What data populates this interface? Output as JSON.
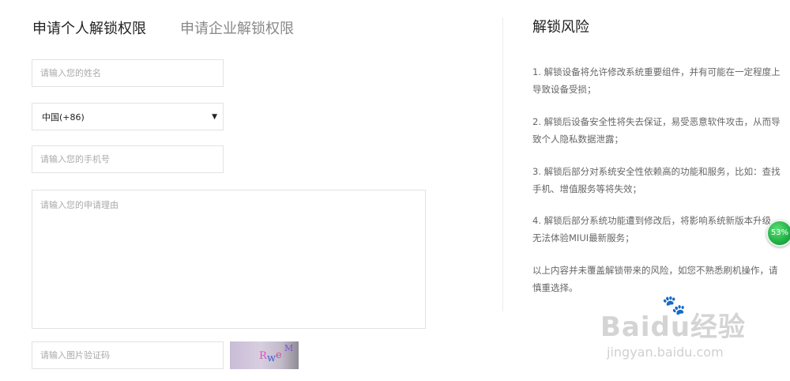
{
  "tabs": {
    "personal": "申请个人解锁权限",
    "enterprise": "申请企业解锁权限"
  },
  "form": {
    "name_placeholder": "请输入您的姓名",
    "country_selected": "中国(+86)",
    "phone_placeholder": "请输入您的手机号",
    "reason_placeholder": "请输入您的申请理由",
    "captcha_placeholder": "请输入图片验证码",
    "captcha_chars": [
      "R",
      "w",
      "e",
      "M"
    ]
  },
  "risk": {
    "title": "解锁风险",
    "items": [
      "1. 解锁设备将允许修改系统重要组件，并有可能在一定程度上导致设备受损；",
      "2. 解锁后设备安全性将失去保证，易受恶意软件攻击，从而导致个人隐私数据泄露；",
      "3. 解锁后部分对系统安全性依赖高的功能和服务，比如：查找手机、增值服务等将失效；",
      "4. 解锁后部分系统功能遭到修改后，将影响系统新版本升级，无法体验MIUI最新服务；",
      "以上内容并未覆盖解锁带来的风险，如您不熟悉刷机操作，请慎重选择。"
    ]
  },
  "badge": {
    "text": "53%"
  },
  "watermark": {
    "brand": "Baidu经验",
    "url": "jingyan.baidu.com"
  },
  "colors": {
    "text_dark": "#222222",
    "text_muted": "#888888",
    "border": "#e2e2e2",
    "badge_green": "#23b347"
  }
}
